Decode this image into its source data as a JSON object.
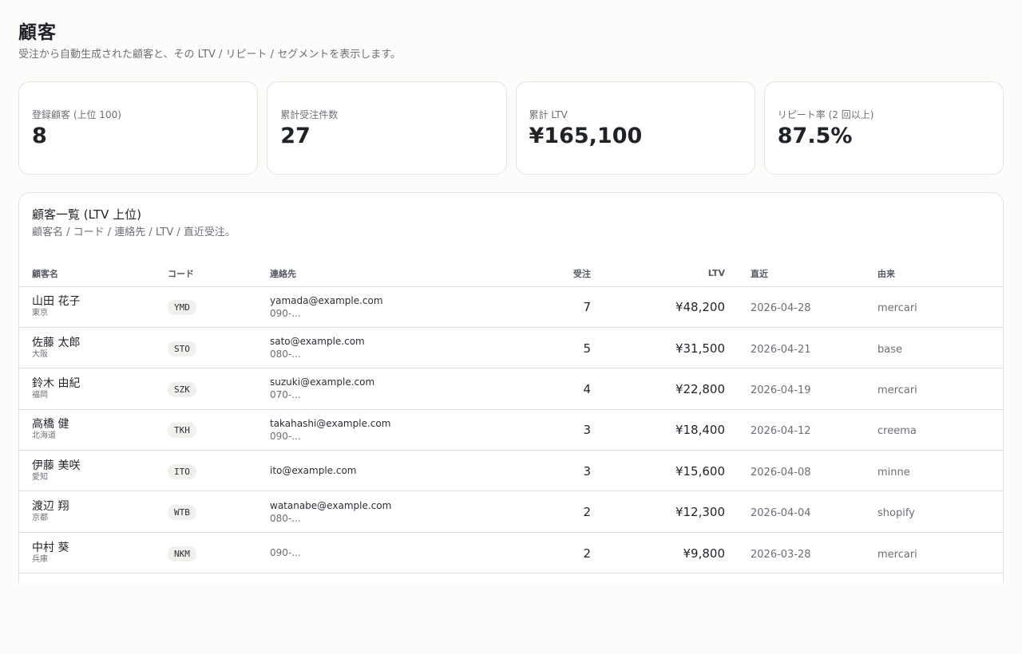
{
  "header": {
    "title": "顧客",
    "subtitle": "受注から自動生成された顧客と、その LTV / リピート / セグメントを表示します。"
  },
  "stats": [
    {
      "label": "登録顧客 (上位 100)",
      "value": "8"
    },
    {
      "label": "累計受注件数",
      "value": "27"
    },
    {
      "label": "累計 LTV",
      "value": "¥165,100"
    },
    {
      "label": "リピート率 (2 回以上)",
      "value": "87.5%"
    }
  ],
  "panel": {
    "title": "顧客一覧 (LTV 上位)",
    "description": "顧客名 / コード / 連絡先 / LTV / 直近受注。"
  },
  "table": {
    "columns": [
      "顧客名",
      "コード",
      "連絡先",
      "受注",
      "LTV",
      "直近",
      "由来"
    ],
    "rows": [
      {
        "name": "山田 花子",
        "region": "東京",
        "code": "YMD",
        "email": "yamada@example.com",
        "phone": "090-...",
        "orders": "7",
        "ltv": "¥48,200",
        "recent": "2026-04-28",
        "source": "mercari"
      },
      {
        "name": "佐藤 太郎",
        "region": "大阪",
        "code": "STO",
        "email": "sato@example.com",
        "phone": "080-...",
        "orders": "5",
        "ltv": "¥31,500",
        "recent": "2026-04-21",
        "source": "base"
      },
      {
        "name": "鈴木 由紀",
        "region": "福岡",
        "code": "SZK",
        "email": "suzuki@example.com",
        "phone": "070-...",
        "orders": "4",
        "ltv": "¥22,800",
        "recent": "2026-04-19",
        "source": "mercari"
      },
      {
        "name": "高橋 健",
        "region": "北海道",
        "code": "TKH",
        "email": "takahashi@example.com",
        "phone": "090-...",
        "orders": "3",
        "ltv": "¥18,400",
        "recent": "2026-04-12",
        "source": "creema"
      },
      {
        "name": "伊藤 美咲",
        "region": "愛知",
        "code": "ITO",
        "email": "ito@example.com",
        "phone": "",
        "orders": "3",
        "ltv": "¥15,600",
        "recent": "2026-04-08",
        "source": "minne"
      },
      {
        "name": "渡辺 翔",
        "region": "京都",
        "code": "WTB",
        "email": "watanabe@example.com",
        "phone": "080-...",
        "orders": "2",
        "ltv": "¥12,300",
        "recent": "2026-04-04",
        "source": "shopify"
      },
      {
        "name": "中村 葵",
        "region": "兵庫",
        "code": "NKM",
        "email": "",
        "phone": "090-...",
        "orders": "2",
        "ltv": "¥9,800",
        "recent": "2026-03-28",
        "source": "mercari"
      }
    ]
  }
}
